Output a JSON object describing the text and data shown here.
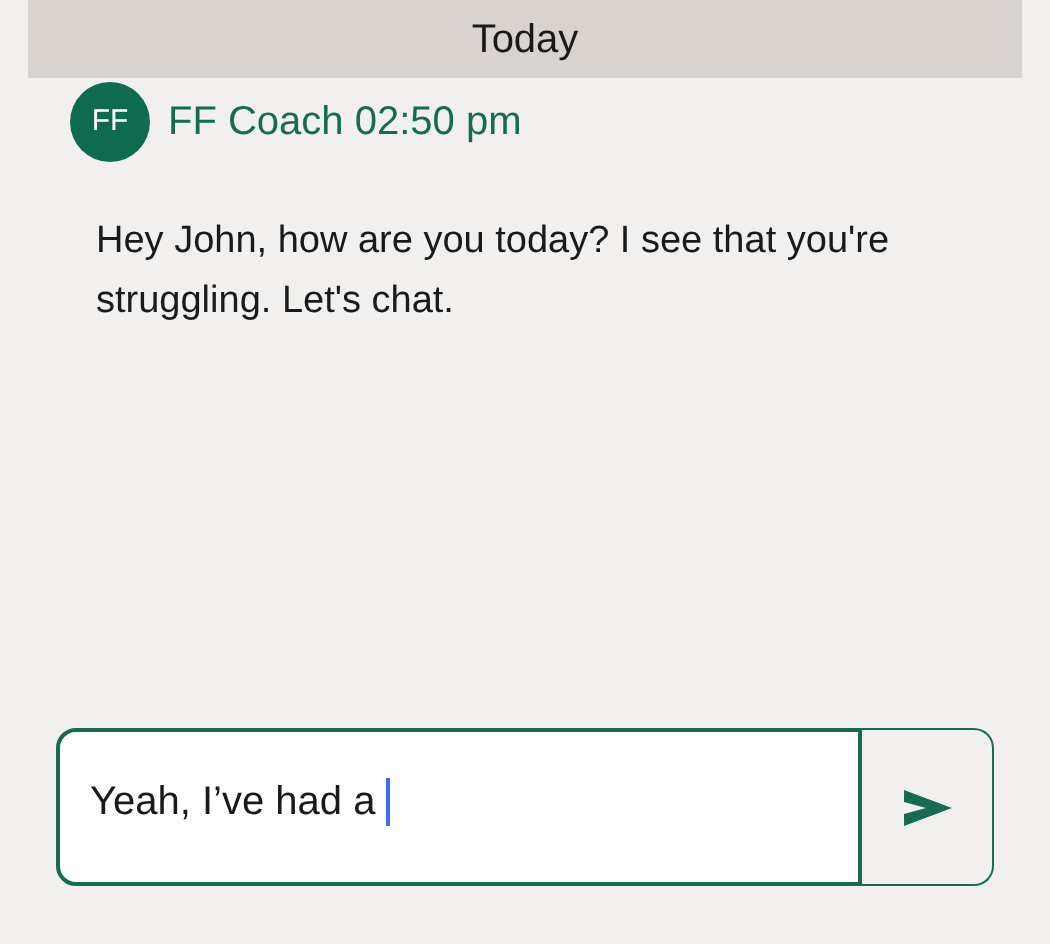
{
  "date_header": "Today",
  "message": {
    "avatar": "FF",
    "sender": "FF Coach",
    "time": "02:50 pm",
    "text": "Hey John, how are you today? I see that you're struggling. Let's chat."
  },
  "composer": {
    "value": "Yeah, I’ve had a",
    "focused": true
  }
}
